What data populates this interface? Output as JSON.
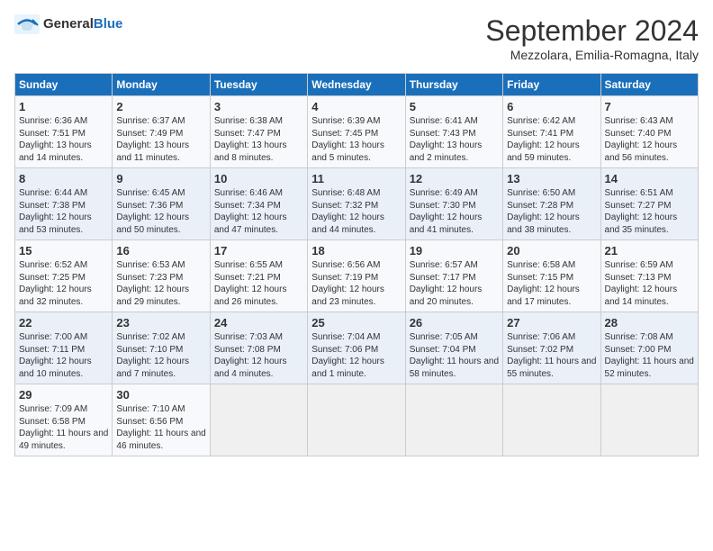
{
  "header": {
    "logo_general": "General",
    "logo_blue": "Blue",
    "month_title": "September 2024",
    "location": "Mezzolara, Emilia-Romagna, Italy"
  },
  "columns": [
    "Sunday",
    "Monday",
    "Tuesday",
    "Wednesday",
    "Thursday",
    "Friday",
    "Saturday"
  ],
  "weeks": [
    [
      {
        "day": "1",
        "sunrise": "Sunrise: 6:36 AM",
        "sunset": "Sunset: 7:51 PM",
        "daylight": "Daylight: 13 hours and 14 minutes."
      },
      {
        "day": "2",
        "sunrise": "Sunrise: 6:37 AM",
        "sunset": "Sunset: 7:49 PM",
        "daylight": "Daylight: 13 hours and 11 minutes."
      },
      {
        "day": "3",
        "sunrise": "Sunrise: 6:38 AM",
        "sunset": "Sunset: 7:47 PM",
        "daylight": "Daylight: 13 hours and 8 minutes."
      },
      {
        "day": "4",
        "sunrise": "Sunrise: 6:39 AM",
        "sunset": "Sunset: 7:45 PM",
        "daylight": "Daylight: 13 hours and 5 minutes."
      },
      {
        "day": "5",
        "sunrise": "Sunrise: 6:41 AM",
        "sunset": "Sunset: 7:43 PM",
        "daylight": "Daylight: 13 hours and 2 minutes."
      },
      {
        "day": "6",
        "sunrise": "Sunrise: 6:42 AM",
        "sunset": "Sunset: 7:41 PM",
        "daylight": "Daylight: 12 hours and 59 minutes."
      },
      {
        "day": "7",
        "sunrise": "Sunrise: 6:43 AM",
        "sunset": "Sunset: 7:40 PM",
        "daylight": "Daylight: 12 hours and 56 minutes."
      }
    ],
    [
      {
        "day": "8",
        "sunrise": "Sunrise: 6:44 AM",
        "sunset": "Sunset: 7:38 PM",
        "daylight": "Daylight: 12 hours and 53 minutes."
      },
      {
        "day": "9",
        "sunrise": "Sunrise: 6:45 AM",
        "sunset": "Sunset: 7:36 PM",
        "daylight": "Daylight: 12 hours and 50 minutes."
      },
      {
        "day": "10",
        "sunrise": "Sunrise: 6:46 AM",
        "sunset": "Sunset: 7:34 PM",
        "daylight": "Daylight: 12 hours and 47 minutes."
      },
      {
        "day": "11",
        "sunrise": "Sunrise: 6:48 AM",
        "sunset": "Sunset: 7:32 PM",
        "daylight": "Daylight: 12 hours and 44 minutes."
      },
      {
        "day": "12",
        "sunrise": "Sunrise: 6:49 AM",
        "sunset": "Sunset: 7:30 PM",
        "daylight": "Daylight: 12 hours and 41 minutes."
      },
      {
        "day": "13",
        "sunrise": "Sunrise: 6:50 AM",
        "sunset": "Sunset: 7:28 PM",
        "daylight": "Daylight: 12 hours and 38 minutes."
      },
      {
        "day": "14",
        "sunrise": "Sunrise: 6:51 AM",
        "sunset": "Sunset: 7:27 PM",
        "daylight": "Daylight: 12 hours and 35 minutes."
      }
    ],
    [
      {
        "day": "15",
        "sunrise": "Sunrise: 6:52 AM",
        "sunset": "Sunset: 7:25 PM",
        "daylight": "Daylight: 12 hours and 32 minutes."
      },
      {
        "day": "16",
        "sunrise": "Sunrise: 6:53 AM",
        "sunset": "Sunset: 7:23 PM",
        "daylight": "Daylight: 12 hours and 29 minutes."
      },
      {
        "day": "17",
        "sunrise": "Sunrise: 6:55 AM",
        "sunset": "Sunset: 7:21 PM",
        "daylight": "Daylight: 12 hours and 26 minutes."
      },
      {
        "day": "18",
        "sunrise": "Sunrise: 6:56 AM",
        "sunset": "Sunset: 7:19 PM",
        "daylight": "Daylight: 12 hours and 23 minutes."
      },
      {
        "day": "19",
        "sunrise": "Sunrise: 6:57 AM",
        "sunset": "Sunset: 7:17 PM",
        "daylight": "Daylight: 12 hours and 20 minutes."
      },
      {
        "day": "20",
        "sunrise": "Sunrise: 6:58 AM",
        "sunset": "Sunset: 7:15 PM",
        "daylight": "Daylight: 12 hours and 17 minutes."
      },
      {
        "day": "21",
        "sunrise": "Sunrise: 6:59 AM",
        "sunset": "Sunset: 7:13 PM",
        "daylight": "Daylight: 12 hours and 14 minutes."
      }
    ],
    [
      {
        "day": "22",
        "sunrise": "Sunrise: 7:00 AM",
        "sunset": "Sunset: 7:11 PM",
        "daylight": "Daylight: 12 hours and 10 minutes."
      },
      {
        "day": "23",
        "sunrise": "Sunrise: 7:02 AM",
        "sunset": "Sunset: 7:10 PM",
        "daylight": "Daylight: 12 hours and 7 minutes."
      },
      {
        "day": "24",
        "sunrise": "Sunrise: 7:03 AM",
        "sunset": "Sunset: 7:08 PM",
        "daylight": "Daylight: 12 hours and 4 minutes."
      },
      {
        "day": "25",
        "sunrise": "Sunrise: 7:04 AM",
        "sunset": "Sunset: 7:06 PM",
        "daylight": "Daylight: 12 hours and 1 minute."
      },
      {
        "day": "26",
        "sunrise": "Sunrise: 7:05 AM",
        "sunset": "Sunset: 7:04 PM",
        "daylight": "Daylight: 11 hours and 58 minutes."
      },
      {
        "day": "27",
        "sunrise": "Sunrise: 7:06 AM",
        "sunset": "Sunset: 7:02 PM",
        "daylight": "Daylight: 11 hours and 55 minutes."
      },
      {
        "day": "28",
        "sunrise": "Sunrise: 7:08 AM",
        "sunset": "Sunset: 7:00 PM",
        "daylight": "Daylight: 11 hours and 52 minutes."
      }
    ],
    [
      {
        "day": "29",
        "sunrise": "Sunrise: 7:09 AM",
        "sunset": "Sunset: 6:58 PM",
        "daylight": "Daylight: 11 hours and 49 minutes."
      },
      {
        "day": "30",
        "sunrise": "Sunrise: 7:10 AM",
        "sunset": "Sunset: 6:56 PM",
        "daylight": "Daylight: 11 hours and 46 minutes."
      },
      null,
      null,
      null,
      null,
      null
    ]
  ]
}
